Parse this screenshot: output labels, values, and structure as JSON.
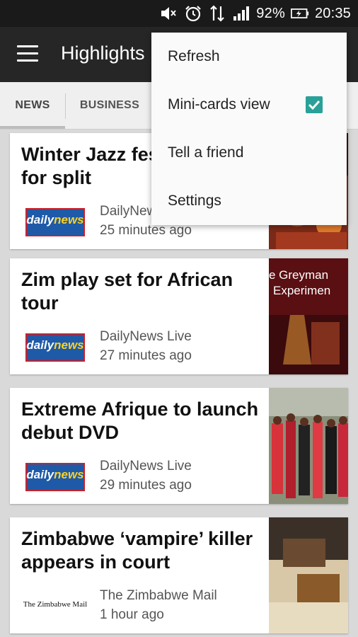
{
  "status_bar": {
    "battery": "92%",
    "time": "20:35",
    "icons": [
      "mute-icon",
      "alarm-icon",
      "data-transfer-icon",
      "signal-icon",
      "battery-charging-icon"
    ]
  },
  "toolbar": {
    "title": "Highlights",
    "menu_icon": "hamburger-menu-icon"
  },
  "tabs": [
    {
      "label": "NEWS",
      "active": true
    },
    {
      "label": "BUSINESS",
      "active": false
    }
  ],
  "articles": [
    {
      "title_line1": "Winter Jazz fes",
      "title_line2": "for split",
      "source": "DailyNews",
      "time": "25 minutes ago",
      "logo": "dailynews"
    },
    {
      "title_line1": "Zim play set for African",
      "title_line2": "tour",
      "source": "DailyNews Live",
      "time": "27 minutes ago",
      "logo": "dailynews",
      "thumb_text1": "e Greyman",
      "thumb_text2": "Experimen"
    },
    {
      "title_line1": "Extreme Afrique to launch",
      "title_line2": "debut DVD",
      "source": "DailyNews Live",
      "time": "29 minutes ago",
      "logo": "dailynews"
    },
    {
      "title_line1": "Zimbabwe ‘vampire’ killer",
      "title_line2": "appears in court",
      "source": "The Zimbabwe Mail",
      "time": "1 hour ago",
      "logo": "zimbabwemail"
    }
  ],
  "logos": {
    "dailynews_text_a": "daily",
    "dailynews_text_b": "news",
    "zimbabwemail_text": "The Zimbabwe Mail"
  },
  "overflow_menu": {
    "items": [
      {
        "label": "Refresh"
      },
      {
        "label": "Mini-cards view",
        "checked": true
      },
      {
        "label": "Tell a friend"
      },
      {
        "label": "Settings"
      }
    ]
  },
  "colors": {
    "toolbar": "#262626",
    "status_bar": "#1a1a1a",
    "checkbox": "#2aa198",
    "background": "#d9d9d9"
  }
}
